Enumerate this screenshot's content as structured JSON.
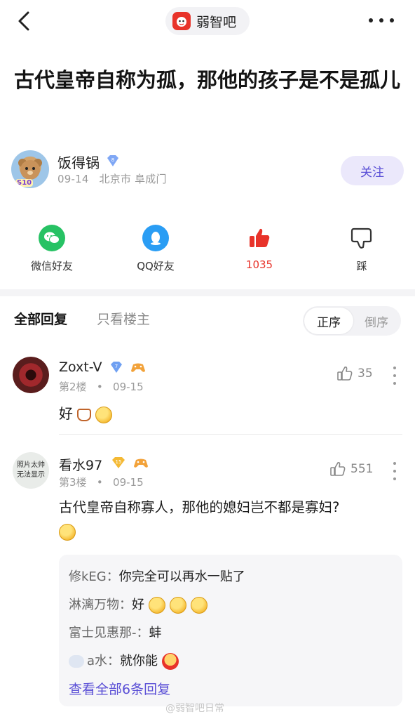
{
  "header": {
    "forum_name": "弱智吧"
  },
  "post": {
    "title": "古代皇帝自称为孤，那他的孩子是不是孤儿"
  },
  "author": {
    "name": "饭得锅",
    "level": "8",
    "date": "09-14",
    "location": "北京市 阜成门",
    "follow_label": "关注",
    "avatar_badge": "S10"
  },
  "share": {
    "wechat_label": "微信好友",
    "qq_label": "QQ好友",
    "like_count": "1035",
    "dislike_label": "踩"
  },
  "filter": {
    "all_replies": "全部回复",
    "op_only": "只看楼主",
    "sort_asc": "正序",
    "sort_desc": "倒序"
  },
  "comments": [
    {
      "name": "Zoxt-V",
      "level": "7",
      "floor": "第2楼",
      "dot": "•",
      "date": "09-15",
      "likes": "35",
      "text": "好"
    },
    {
      "name": "看水97",
      "level": "15",
      "floor": "第3楼",
      "dot": "•",
      "date": "09-15",
      "likes": "551",
      "text": "古代皇帝自称寡人，那他的媳妇岂不都是寡妇?",
      "avatar_text_1": "照片太帅",
      "avatar_text_2": "无法显示"
    }
  ],
  "replies": [
    {
      "name": "修kEG：",
      "text": "你完全可以再水一贴了"
    },
    {
      "name": "淋漓万物：",
      "text": "好"
    },
    {
      "name": "富士见惠那-：",
      "text": "蚌"
    },
    {
      "name": "a水：",
      "text": "就你能"
    }
  ],
  "view_all_replies": "查看全部6条回复",
  "watermark": "@弱智吧日常"
}
